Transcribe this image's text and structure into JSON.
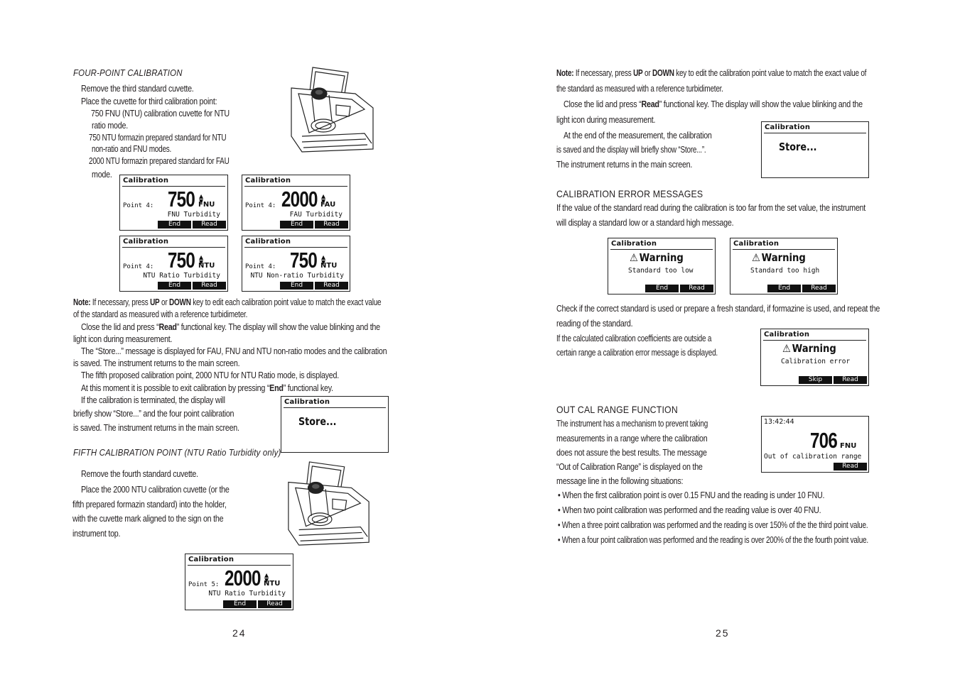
{
  "left_page": {
    "section_title": "FOUR-POINT CALIBRATION",
    "intro_lines": [
      "Remove the third standard cuvette.",
      "Place the cuvette for third calibration point:",
      "750 FNU (NTU) calibration cuvette for NTU",
      "ratio mode.",
      "750 NTU formazin prepared standard for NTU",
      "non-ratio and FNU modes.",
      "2000 NTU formazin prepared standard for FAU",
      "mode."
    ],
    "displays": [
      {
        "title": "Calibration",
        "point": "Point 4:",
        "value": "750",
        "unit": "FNU",
        "mode": "FNU Turbidity",
        "keys": [
          "End",
          "Read"
        ]
      },
      {
        "title": "Calibration",
        "point": "Point 4:",
        "value": "2000",
        "unit": "FAU",
        "mode": "FAU Turbidity",
        "keys": [
          "End",
          "Read"
        ]
      },
      {
        "title": "Calibration",
        "point": "Point 4:",
        "value": "750",
        "unit": "NTU",
        "mode": "NTU Ratio Turbidity",
        "keys": [
          "End",
          "Read"
        ]
      },
      {
        "title": "Calibration",
        "point": "Point 4:",
        "value": "750",
        "unit": "NTU",
        "mode": "NTU Non-ratio Turbidity",
        "keys": [
          "End",
          "Read"
        ]
      }
    ],
    "note": {
      "label": "Note:",
      "l1_a": " If necessary, press ",
      "up": "UP",
      "or": " or ",
      "down": "DOWN",
      "l1_b": " key to edit each calibration point value to match the exact value",
      "l2": "of the standard as measured with a reference turbidimeter."
    },
    "para_read": {
      "a": "Close the lid and press “",
      "key": "Read",
      "b": "” functional key. The display will show the value blinking and the",
      "l2": "light icon during  measurement."
    },
    "para_store": [
      "The “Store...” message is displayed for FAU, FNU and NTU non-ratio modes and the calibration",
      "is saved. The instrument returns to the main screen."
    ],
    "para_fifth": "The fifth proposed calibration point, 2000 NTU for NTU Ratio mode, is displayed.",
    "para_exit": {
      "a": "At this moment it is possible to exit calibration by pressing “",
      "key": "End",
      "b": "” functional key."
    },
    "para_terminated": [
      "If the calibration is terminated, the display will",
      "briefly show “Store...” and the four point calibration",
      "is saved. The instrument returns in the main screen."
    ],
    "store_display": {
      "title": "Calibration",
      "text": "Store..."
    },
    "fifth_title": "FIFTH CALIBRATION POINT (NTU Ratio Turbidity only)",
    "fifth_lines": [
      "Remove the fourth standard cuvette.",
      "Place the 2000 NTU calibration cuvette (or the",
      "fifth prepared formazin standard) into the holder,",
      "with the cuvette mark aligned to the sign on the",
      "instrument top."
    ],
    "fifth_display": {
      "title": "Calibration",
      "point": "Point 5:",
      "value": "2000",
      "unit": "NTU",
      "mode": "NTU Ratio Turbidity",
      "keys": [
        "End",
        "Read"
      ]
    },
    "page_number": "24"
  },
  "right_page": {
    "note": {
      "label": "Note:",
      "l1_a": " If necessary, press ",
      "up": "UP",
      "or": " or ",
      "down": "DOWN",
      "l1_b": " key to edit the calibration point value to match the exact value of",
      "l2": "the standard as measured with a reference turbidimeter."
    },
    "para_read": {
      "a": "Close the lid and press “",
      "key": "Read",
      "b": "” functional key. The display will show the value blinking and the",
      "l2": "light icon during  measurement."
    },
    "para_end": [
      "At the end of the measurement, the calibration",
      "is saved and the display will briefly show “Store...”.",
      "The instrument returns in the main screen."
    ],
    "store_display": {
      "title": "Calibration",
      "text": "Store..."
    },
    "error_heading": "CALIBRATION ERROR MESSAGES",
    "error_intro": [
      "If the value of the standard read during the calibration is too far from the set value, the instrument",
      "will display a standard low or a standard high message."
    ],
    "warning_displays": [
      {
        "title": "Calibration",
        "warning": "Warning",
        "message": "Standard too low",
        "keys": [
          "End",
          "Read"
        ]
      },
      {
        "title": "Calibration",
        "warning": "Warning",
        "message": "Standard too high",
        "keys": [
          "End",
          "Read"
        ]
      }
    ],
    "check_para": [
      "Check if the correct standard is used or prepare a fresh standard, if formazine is used, and repeat the",
      "reading of the standard."
    ],
    "coeff_para": [
      "If the calculated calibration coefficients are outside a",
      "certain range a calibration error message is displayed."
    ],
    "cal_error_display": {
      "title": "Calibration",
      "warning": "Warning",
      "message": "Calibration error",
      "keys": [
        "Skip",
        "Read"
      ]
    },
    "outcal_heading": "OUT CAL RANGE FUNCTION",
    "outcal_para": [
      "The instrument has a mechanism to prevent taking",
      "measurements in a range where the calibration",
      "does not assure the best results. The message",
      "“Out of Calibration Range” is displayed on the",
      "message line in the following situations:"
    ],
    "outcal_display": {
      "time": "13:42:44",
      "value": "706",
      "unit": "FNU",
      "message": "Out of calibration range",
      "key": "Read"
    },
    "bullets": [
      "• When the first calibration point is over 0.15 FNU and the reading is under 10 FNU.",
      "• When two point calibration was performed and the reading value is over 40 FNU.",
      "• When a three point calibration was performed and the reading is over 150% of the the third point value.",
      "• When a four point calibration was performed and the reading is over 200% of the the fourth point value."
    ],
    "page_number": "25"
  }
}
